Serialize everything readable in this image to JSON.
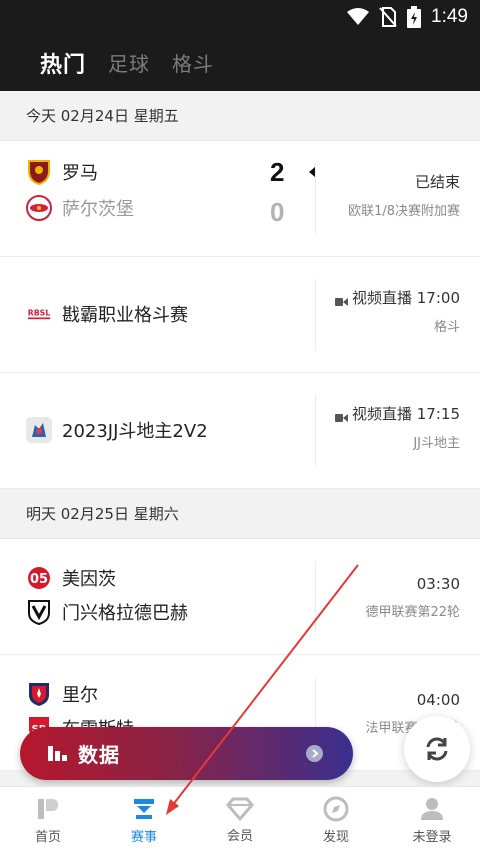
{
  "status_bar": {
    "time": "1:49"
  },
  "top_tabs": [
    {
      "label": "热门",
      "active": true
    },
    {
      "label": "足球",
      "active": false
    },
    {
      "label": "格斗",
      "active": false
    }
  ],
  "sections": [
    {
      "date": "今天 02月24日 星期五",
      "matches": [
        {
          "home": {
            "name": "罗马",
            "score": "2",
            "logo": "as-roma-logo"
          },
          "away": {
            "name": "萨尔茨堡",
            "score": "0",
            "logo": "salzburg-logo"
          },
          "status": "已结束",
          "league": "欧联1/8决赛附加赛"
        },
        {
          "event": "戡霸职业格斗赛",
          "logo": "wbc-fight-logo",
          "status": "视频直播 17:00",
          "league": "格斗"
        },
        {
          "event": "2023JJ斗地主2V2",
          "logo": "jj-doudizhu-logo",
          "status": "视频直播 17:15",
          "league": "JJ斗地主"
        }
      ]
    },
    {
      "date": "明天 02月25日 星期六",
      "matches": [
        {
          "home": {
            "name": "美因茨",
            "logo": "mainz-logo"
          },
          "away": {
            "name": "门兴格拉德巴赫",
            "logo": "gladbach-logo"
          },
          "time": "03:30",
          "league": "德甲联赛第22轮"
        },
        {
          "home": {
            "name": "里尔",
            "logo": "lille-logo"
          },
          "away": {
            "name": "布雷斯特",
            "logo": "brest-logo"
          },
          "time": "04:00",
          "league": "法甲联赛第25轮"
        }
      ]
    }
  ],
  "floating_bar": {
    "label": "数据"
  },
  "bottom_nav": [
    {
      "label": "首页",
      "icon": "home-p-icon",
      "active": false
    },
    {
      "label": "赛事",
      "icon": "events-icon",
      "active": true
    },
    {
      "label": "会员",
      "icon": "diamond-icon",
      "active": false
    },
    {
      "label": "发现",
      "icon": "compass-icon",
      "active": false
    },
    {
      "label": "未登录",
      "icon": "user-icon",
      "active": false
    }
  ],
  "colors": {
    "accent": "#1e88e5",
    "header_bg": "#1b1b1b",
    "bar_start": "#b5182c",
    "bar_end": "#3a2f8f",
    "annotation": "#e53935"
  }
}
